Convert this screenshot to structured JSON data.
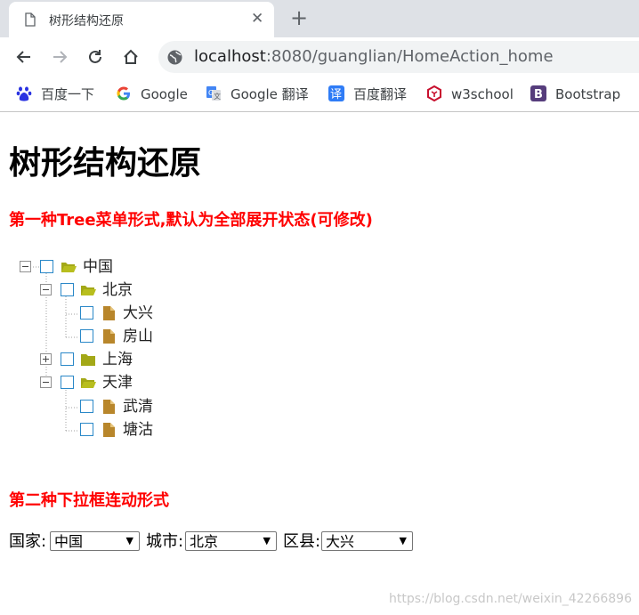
{
  "browser": {
    "tab_title": "树形结构还原",
    "close_glyph": "✕",
    "new_tab_glyph": "+",
    "url_host": "localhost",
    "url_rest": ":8080/guanglian/HomeAction_home",
    "bookmarks": [
      {
        "label": "百度一下",
        "icon": "baidu-icon",
        "color": "#2932e1"
      },
      {
        "label": "Google",
        "icon": "google-icon",
        "color": "#4285f4"
      },
      {
        "label": "Google 翻译",
        "icon": "google-translate-icon",
        "color": "#4285f4"
      },
      {
        "label": "百度翻译",
        "icon": "baidu-translate-icon",
        "color": "#2f7cf6"
      },
      {
        "label": "w3school",
        "icon": "w3school-icon",
        "color": "#c8102e"
      },
      {
        "label": "Bootstrap",
        "icon": "bootstrap-icon",
        "color": "#563d7c"
      }
    ]
  },
  "page": {
    "title": "树形结构还原",
    "section1_title": "第一种Tree菜单形式,默认为全部展开状态(可修改)",
    "section2_title": "第二种下拉框连动形式",
    "tree": [
      {
        "label": "中国",
        "level": 0,
        "type": "folder",
        "state": "expanded"
      },
      {
        "label": "北京",
        "level": 1,
        "type": "folder",
        "state": "expanded"
      },
      {
        "label": "大兴",
        "level": 2,
        "type": "file"
      },
      {
        "label": "房山",
        "level": 2,
        "type": "file"
      },
      {
        "label": "上海",
        "level": 1,
        "type": "folder",
        "state": "collapsed"
      },
      {
        "label": "天津",
        "level": 1,
        "type": "folder",
        "state": "expanded"
      },
      {
        "label": "武清",
        "level": 2,
        "type": "file"
      },
      {
        "label": "塘沽",
        "level": 2,
        "type": "file"
      }
    ],
    "selects": {
      "country_label": "国家:",
      "country_value": "中国",
      "city_label": "城市:",
      "city_value": "北京",
      "district_label": "区县:",
      "district_value": "大兴",
      "arrow": "▼"
    }
  },
  "colors": {
    "heading_red": "#ff0000",
    "checkbox_blue": "#2a88c8",
    "folder_olive": "#a3a817",
    "file_gold": "#b8862b"
  },
  "watermark": "https://blog.csdn.net/weixin_42266896"
}
